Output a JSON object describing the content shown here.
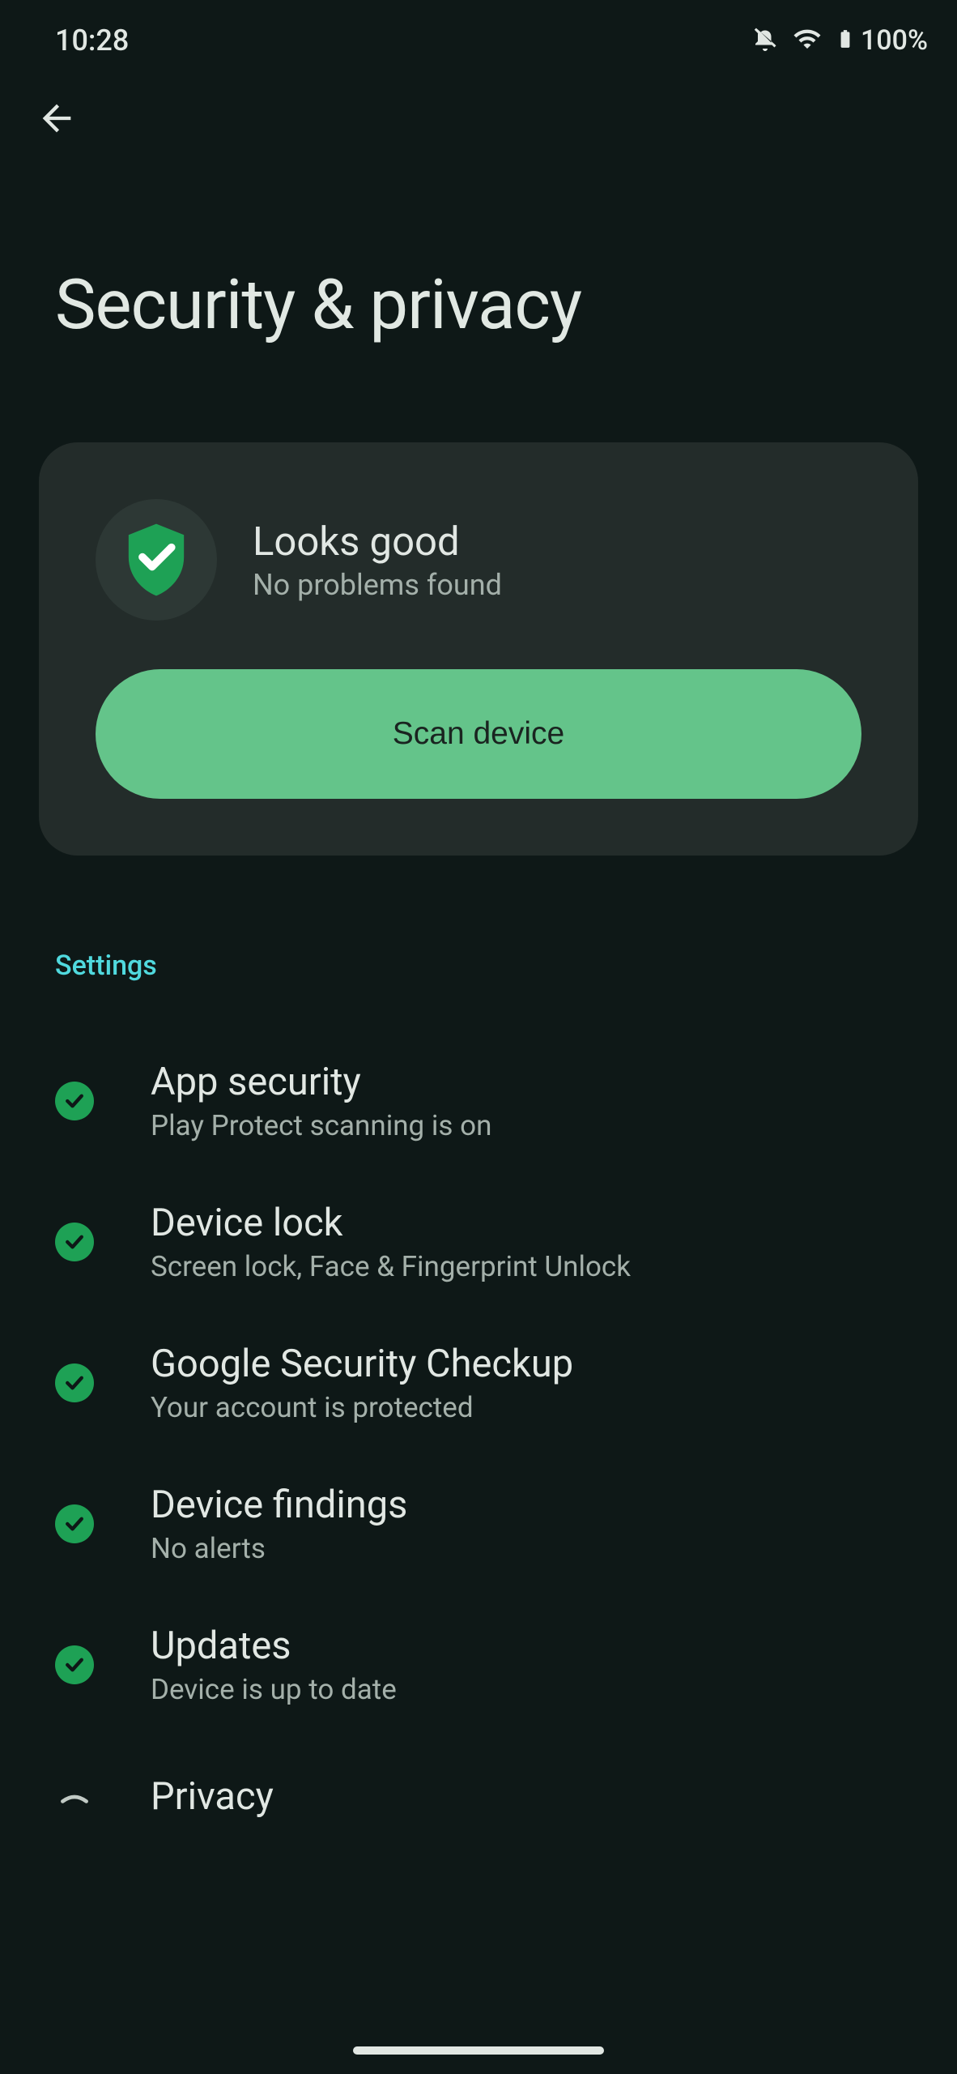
{
  "status_bar": {
    "time": "10:28",
    "battery_pct": "100%"
  },
  "page": {
    "title": "Security & privacy"
  },
  "status_card": {
    "title": "Looks good",
    "subtitle": "No problems found",
    "button_label": "Scan device"
  },
  "section_label": "Settings",
  "settings": [
    {
      "title": "App security",
      "subtitle": "Play Protect scanning is on",
      "status": "ok"
    },
    {
      "title": "Device lock",
      "subtitle": "Screen lock, Face & Fingerprint Unlock",
      "status": "ok"
    },
    {
      "title": "Google Security Checkup",
      "subtitle": "Your account is protected",
      "status": "ok"
    },
    {
      "title": "Device findings",
      "subtitle": "No alerts",
      "status": "ok"
    },
    {
      "title": "Updates",
      "subtitle": "Device is up to date",
      "status": "ok"
    },
    {
      "title": "Privacy",
      "subtitle": "",
      "status": "expand"
    }
  ],
  "colors": {
    "background": "#0e1817",
    "card": "#232c2a",
    "accent_green": "#64c48a",
    "check_green": "#1ea155",
    "teal": "#50d9de",
    "text_primary": "#e1e7e3",
    "text_secondary": "#a4b0aa"
  }
}
